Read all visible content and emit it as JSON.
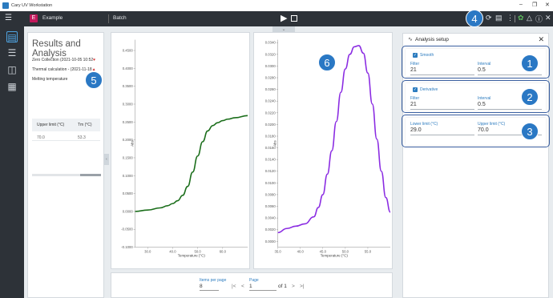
{
  "window": {
    "title": "Cary UV Workstation",
    "minimize_glyph": "–",
    "restore_glyph": "❐",
    "close_glyph": "✕"
  },
  "toolbar": {
    "menu_icon": "menu-icon",
    "workspace_icon_letter": "E",
    "workspace_name": "Example",
    "batch_label": "Batch",
    "icons": [
      "refresh-icon",
      "report-icon",
      "more-icon",
      "leaf-icon",
      "bell-icon",
      "help-icon",
      "close-icon"
    ],
    "accent_green": "#5cb85c"
  },
  "sidebar": {
    "items": [
      "analysis-icon",
      "settings-sliders-icon",
      "map-icon",
      "clipboard-icon"
    ]
  },
  "results": {
    "title": "Results and Analysis",
    "lines": [
      "Zero Collection (2021-10-05 10:52",
      "Thermal calculation - (2021-11-18",
      "Melting temperature"
    ],
    "table": {
      "headers": [
        "Upper limit (°C)",
        "Tm (°C)"
      ],
      "rows": [
        [
          "70.0",
          "53.3"
        ]
      ]
    }
  },
  "chart_data": [
    {
      "type": "line",
      "title": "",
      "xlabel": "Temperature (°C)",
      "ylabel": "Abs",
      "xlim": [
        25,
        70
      ],
      "ylim": [
        -0.1,
        0.48
      ],
      "xticks": [
        30.0,
        40.0,
        50.0,
        60.0
      ],
      "yticks": [
        -0.1,
        -0.05,
        0.0,
        0.05,
        0.1,
        0.15,
        0.2,
        0.25,
        0.3,
        0.35,
        0.4,
        0.45
      ],
      "ytick_labels": [
        "-0.1000",
        "-0.0500",
        "0.0000",
        "0.0500",
        "0.1000",
        "0.1500",
        "0.2000",
        "0.2500",
        "0.3000",
        "0.3500",
        "0.4000",
        "0.4500"
      ],
      "color": "#1b6e1b",
      "series": [
        {
          "x": [
            25,
            30,
            35,
            38,
            40,
            42,
            44,
            46,
            48,
            50,
            52,
            54,
            56,
            58,
            60,
            62,
            65,
            70
          ],
          "y": [
            0.0,
            0.004,
            0.01,
            0.016,
            0.022,
            0.03,
            0.045,
            0.07,
            0.11,
            0.155,
            0.195,
            0.225,
            0.24,
            0.248,
            0.254,
            0.258,
            0.262,
            0.268
          ]
        }
      ]
    },
    {
      "type": "line",
      "title": "",
      "xlabel": "Temperature (°C)",
      "ylabel": "Abs",
      "xlim": [
        35,
        60
      ],
      "ylim": [
        -0.001,
        0.0345
      ],
      "xticks": [
        35.0,
        40.0,
        45.0,
        50.0,
        55.0
      ],
      "yticks": [
        0.0,
        0.002,
        0.004,
        0.006,
        0.008,
        0.01,
        0.012,
        0.014,
        0.016,
        0.018,
        0.02,
        0.022,
        0.024,
        0.026,
        0.028,
        0.03,
        0.032,
        0.034
      ],
      "ytick_labels": [
        "0.0000",
        "0.0020",
        "0.0040",
        "0.0060",
        "0.0080",
        "0.0100",
        "0.0120",
        "0.0140",
        "0.0160",
        "0.0180",
        "0.0200",
        "0.0220",
        "0.0240",
        "0.0260",
        "0.0280",
        "0.0300",
        "0.0320",
        "0.0340"
      ],
      "color": "#8a2be2",
      "series": [
        {
          "x": [
            35,
            37,
            39,
            41,
            43,
            44,
            45,
            46,
            47,
            48,
            49,
            50,
            51,
            52,
            53,
            54,
            55,
            56,
            57,
            58,
            59,
            60
          ],
          "y": [
            0.0015,
            0.0022,
            0.0026,
            0.003,
            0.0042,
            0.0058,
            0.008,
            0.0115,
            0.0155,
            0.0205,
            0.0255,
            0.0295,
            0.032,
            0.0333,
            0.0335,
            0.0322,
            0.0288,
            0.0235,
            0.0175,
            0.012,
            0.0075,
            0.005
          ]
        }
      ]
    }
  ],
  "pager": {
    "items_per_page_label": "Items per page",
    "items_per_page_value": "8",
    "page_label": "Page",
    "page_value": "1",
    "of_text": "of 1",
    "first_glyph": "|<",
    "prev_glyph": "<",
    "next_glyph": ">",
    "last_glyph": ">|"
  },
  "analysis_setup": {
    "title": "Analysis setup",
    "smooth": {
      "label": "Smooth",
      "filter_label": "Filter",
      "filter_value": "21",
      "interval_label": "Interval",
      "interval_value": "0.5"
    },
    "derivative": {
      "label": "Derivative",
      "filter_label": "Filter",
      "filter_value": "21",
      "interval_label": "Interval",
      "interval_value": "0.5"
    },
    "limits": {
      "lower_label": "Lower limit (°C)",
      "lower_value": "29.0",
      "upper_label": "Upper limit (°C)",
      "upper_value": "70.0"
    }
  },
  "callouts": [
    "1",
    "2",
    "3",
    "4",
    "5",
    "6"
  ]
}
